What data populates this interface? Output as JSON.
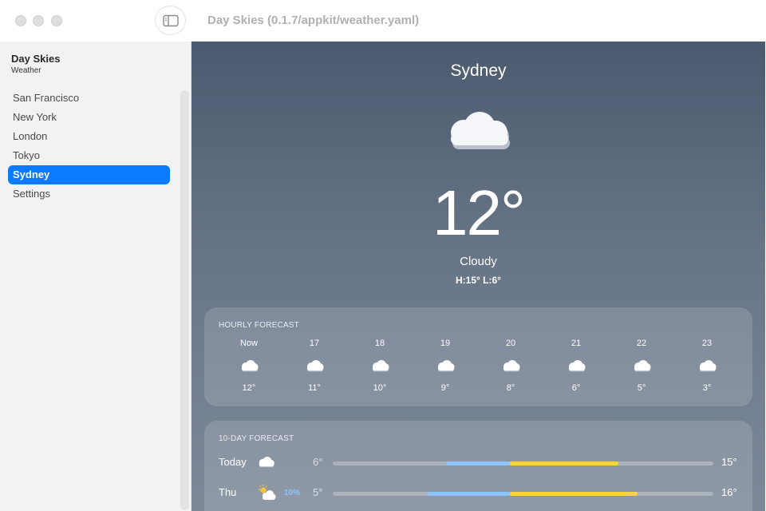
{
  "window": {
    "title": "Day Skies (0.1.7/appkit/weather.yaml)"
  },
  "sidebar": {
    "app_name": "Day Skies",
    "app_subtitle": "Weather",
    "items": [
      {
        "label": "San Francisco",
        "active": false
      },
      {
        "label": "New York",
        "active": false
      },
      {
        "label": "London",
        "active": false
      },
      {
        "label": "Tokyo",
        "active": false
      },
      {
        "label": "Sydney",
        "active": true
      },
      {
        "label": "Settings",
        "active": false
      }
    ]
  },
  "current": {
    "city": "Sydney",
    "icon": "cloud-icon",
    "temperature": "12°",
    "condition": "Cloudy",
    "high_low": "H:15° L:6°"
  },
  "hourly": {
    "title": "HOURLY FORECAST",
    "hours": [
      {
        "label": "Now",
        "icon": "cloud-icon",
        "temp": "12°"
      },
      {
        "label": "17",
        "icon": "cloud-icon",
        "temp": "11°"
      },
      {
        "label": "18",
        "icon": "cloud-icon",
        "temp": "10°"
      },
      {
        "label": "19",
        "icon": "cloud-icon",
        "temp": "9°"
      },
      {
        "label": "20",
        "icon": "cloud-icon",
        "temp": "8°"
      },
      {
        "label": "21",
        "icon": "cloud-icon",
        "temp": "6°"
      },
      {
        "label": "22",
        "icon": "cloud-icon",
        "temp": "5°"
      },
      {
        "label": "23",
        "icon": "cloud-icon",
        "temp": "3°"
      }
    ]
  },
  "daily": {
    "title": "10-DAY FORECAST",
    "range_min": 0,
    "range_max": 20,
    "days": [
      {
        "day": "Today",
        "icon": "cloud-icon",
        "precip": "",
        "low": "6°",
        "high": "15°",
        "low_value": 6,
        "high_value": 15
      },
      {
        "day": "Thu",
        "icon": "partly-sunny-icon",
        "precip": "10%",
        "low": "5°",
        "high": "16°",
        "low_value": 5,
        "high_value": 16
      }
    ]
  },
  "colors": {
    "accent": "#0a7aff",
    "bar_cool": "#8ec5ff",
    "bar_warm": "#ffd04a",
    "precip": "#8cc4ff"
  }
}
